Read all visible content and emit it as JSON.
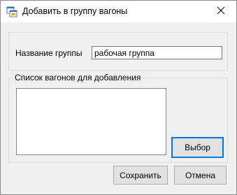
{
  "window": {
    "title": "Добавить в группу вагоны",
    "icons": {
      "app": "app-window-icon",
      "close": "close-icon"
    }
  },
  "group_name": {
    "label": "Название группы",
    "value": "рабочая группа"
  },
  "wagons": {
    "caption": "Список вагонов для добавления",
    "items": [],
    "select_label": "Выбор"
  },
  "footer": {
    "save_label": "Сохранить",
    "cancel_label": "Отмена"
  },
  "colors": {
    "focus_border": "#0078d7",
    "button_bg": "#e1e1e1",
    "form_bg": "#f0f0f0"
  }
}
